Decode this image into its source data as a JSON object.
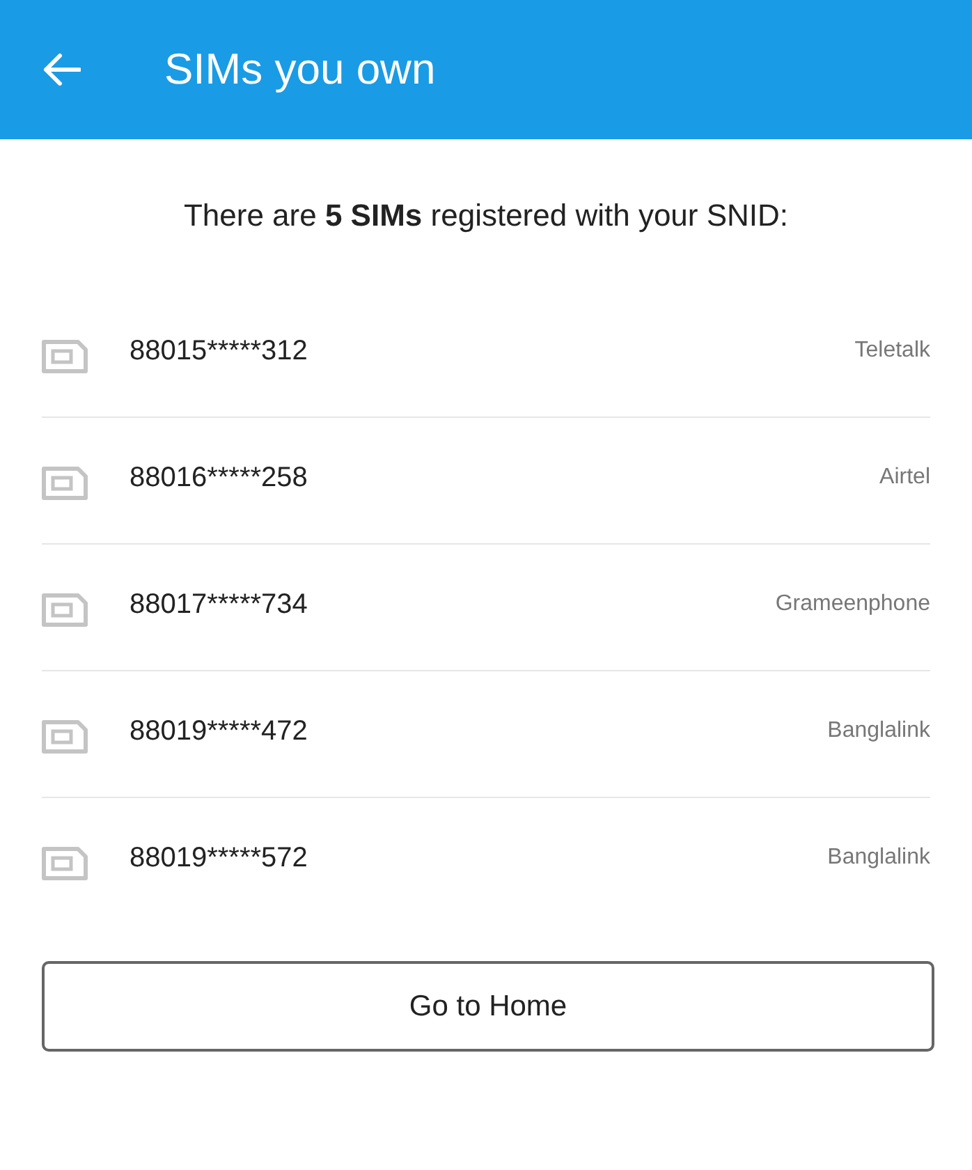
{
  "app_bar": {
    "title": "SIMs you own"
  },
  "summary": "There are **5 SIMs** registered with your SNID:",
  "sims": [
    {
      "number": "88015*****312",
      "operator": "Teletalk"
    },
    {
      "number": "88016*****258",
      "operator": "Airtel"
    },
    {
      "number": "88017*****734",
      "operator": "Grameenphone"
    },
    {
      "number": "88019*****472",
      "operator": "Banglalink"
    },
    {
      "number": "88019*****572",
      "operator": "Banglalink"
    }
  ],
  "button": {
    "label": "Go to Home"
  }
}
